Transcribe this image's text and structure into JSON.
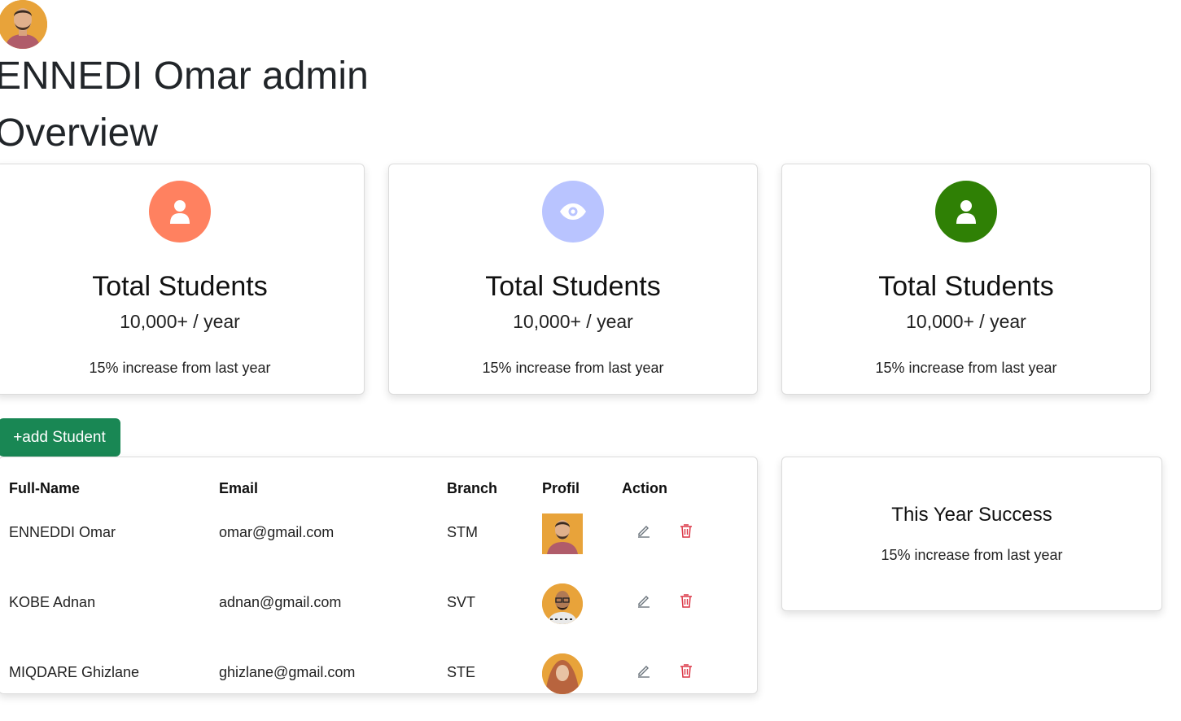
{
  "header": {
    "user_name": "ENNEDI Omar admin",
    "section_title": "Overview"
  },
  "stat_cards": [
    {
      "title": "Total Students",
      "value": "10,000+ / year",
      "note": "15% increase from last year",
      "icon": "user-icon",
      "icon_bg": "#ff8160"
    },
    {
      "title": "Total Students",
      "value": "10,000+ / year",
      "note": "15% increase from last year",
      "icon": "eye-icon",
      "icon_bg": "#b9c4ff"
    },
    {
      "title": "Total Students",
      "value": "10,000+ / year",
      "note": "15% increase from last year",
      "icon": "user-icon",
      "icon_bg": "#2f8005"
    }
  ],
  "add_button_label": "+add Student",
  "table": {
    "columns": [
      "Full-Name",
      "Email",
      "Branch",
      "Profil",
      "Action"
    ],
    "rows": [
      {
        "name": "ENNEDDI Omar",
        "email": "omar@gmail.com",
        "branch": "STM"
      },
      {
        "name": "KOBE Adnan",
        "email": "adnan@gmail.com",
        "branch": "SVT"
      },
      {
        "name": "MIQDARE Ghizlane",
        "email": "ghizlane@gmail.com",
        "branch": "STE"
      }
    ]
  },
  "success_card": {
    "title": "This Year Success",
    "note": "15% increase from last year"
  },
  "colors": {
    "accent_green": "#198754",
    "delete_red": "#dc3545",
    "edit_gray": "#6c757d"
  }
}
